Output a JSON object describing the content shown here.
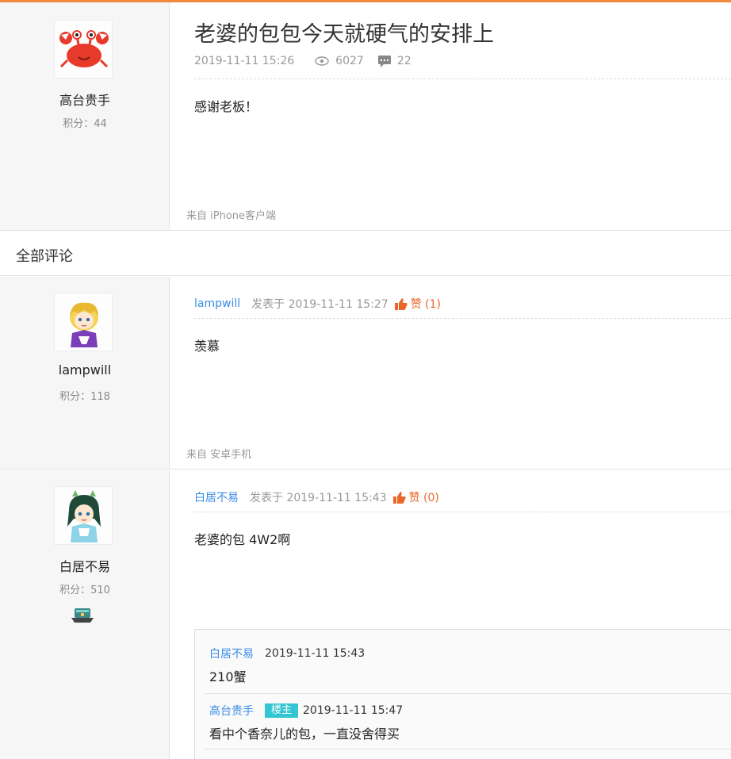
{
  "post": {
    "title": "老婆的包包今天就硬气的安排上",
    "date": "2019-11-11 15:26",
    "views": "6027",
    "comments": "22",
    "content": "感谢老板！",
    "source": "来自 iPhone客户端",
    "author": {
      "name": "高台贵手",
      "score": "积分：44",
      "avatar": "crab-avatar"
    }
  },
  "comments_header": "全部评论",
  "comments": [
    {
      "user": "lampwill",
      "posted": "发表于 2019-11-11 15:27",
      "like": "赞 (1)",
      "content": "羡慕",
      "source": "来自 安卓手机",
      "score": "积分：118",
      "avatar": "blonde-avatar"
    },
    {
      "user": "白居不易",
      "posted": "发表于 2019-11-11 15:43",
      "like": "赞 (0)",
      "content": "老婆的包 4W2啊",
      "score": "积分：510",
      "avatar": "green-hair-avatar",
      "badge_icon": "hat-badge-icon",
      "replies": [
        {
          "user": "白居不易",
          "time": "2019-11-11 15:43",
          "text": "210蟹"
        },
        {
          "user": "高台贵手",
          "tag": "楼主",
          "time": "2019-11-11 15:47",
          "text": "看中个香奈儿的包，一直没舍得买"
        }
      ]
    }
  ],
  "colors": {
    "accent": "#f08a3c",
    "link": "#3a8ee6",
    "like": "#e9672a",
    "owner_tag": "#32c5d2"
  }
}
